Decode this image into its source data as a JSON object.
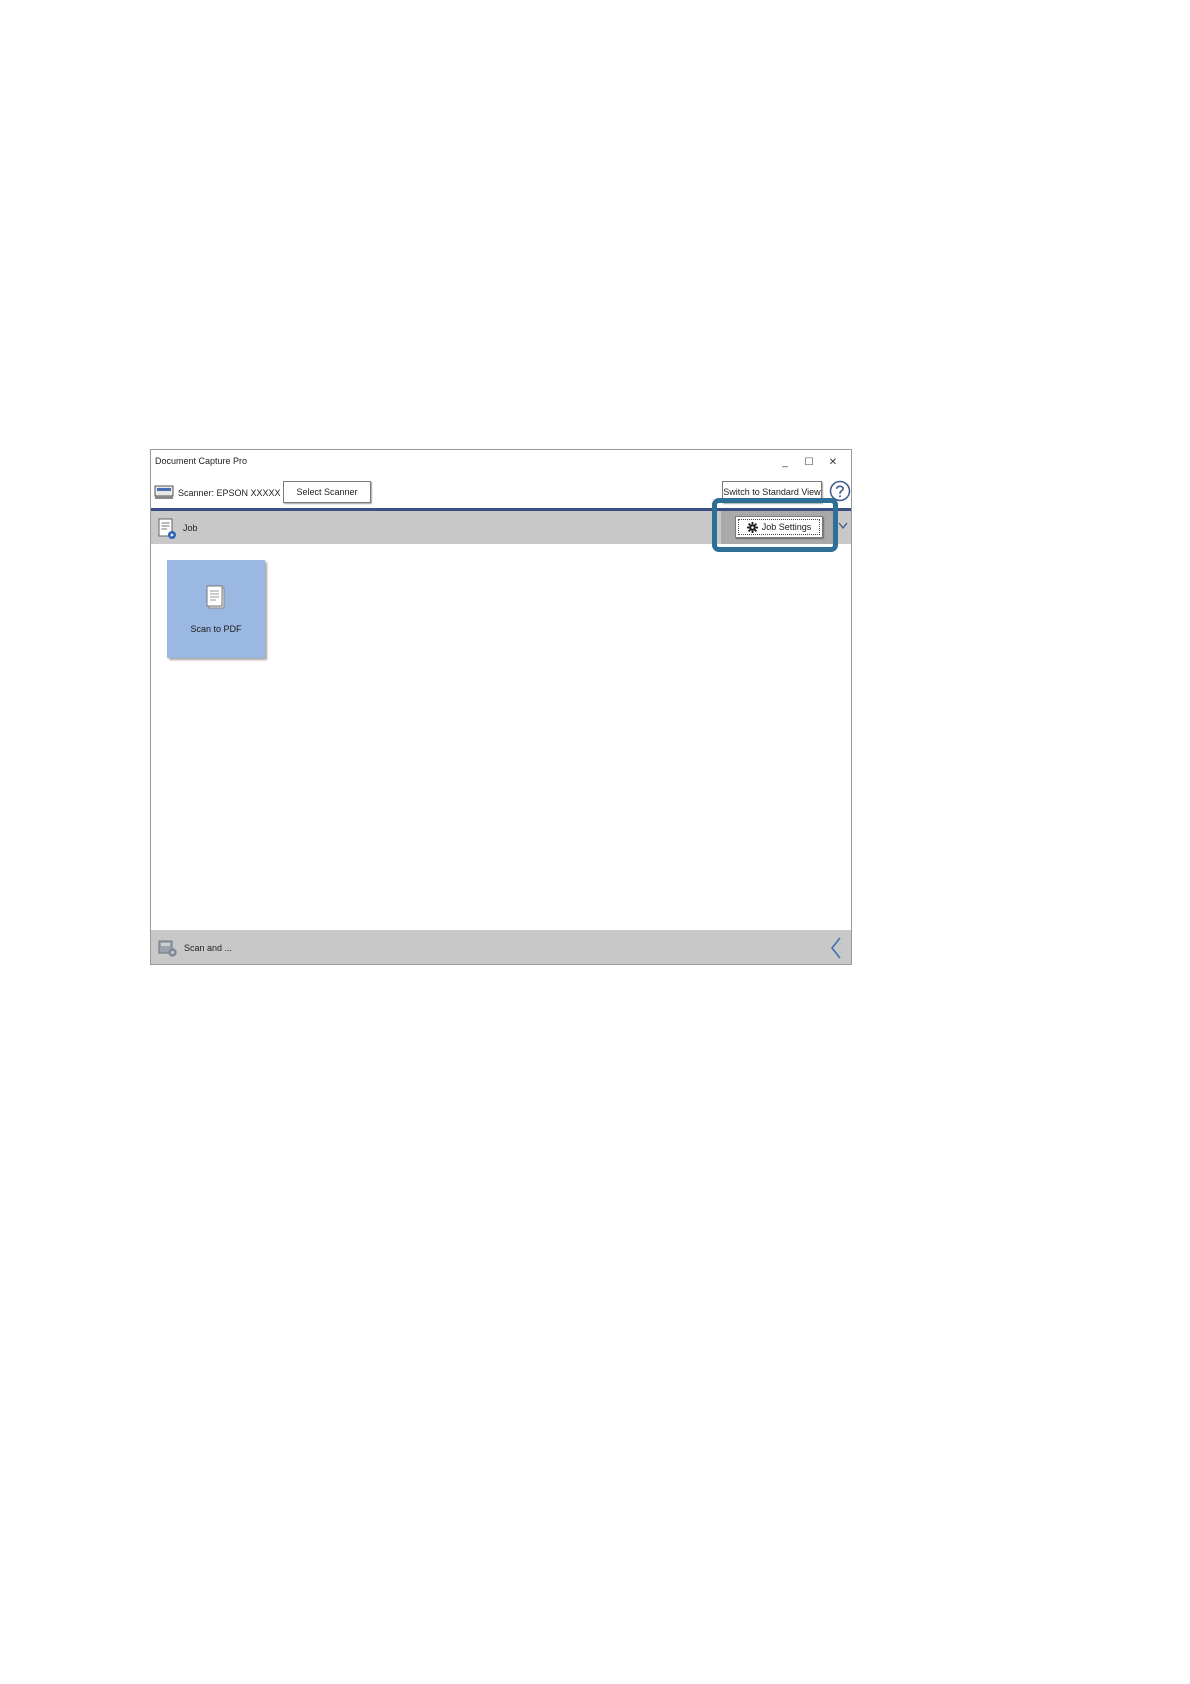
{
  "window": {
    "title": "Document Capture Pro",
    "controls": {
      "minimize": "_",
      "maximize": "☐",
      "close": "✕"
    }
  },
  "toolbar": {
    "scanner_label": "Scanner: EPSON XXXXX",
    "select_scanner_label": "Select Scanner",
    "switch_view_label": "Switch to Standard View",
    "help_icon": "help-icon"
  },
  "job_bar": {
    "label": "Job",
    "job_settings_label": "Job Settings"
  },
  "jobs": [
    {
      "label": "Scan to PDF",
      "icon": "document-icon"
    }
  ],
  "bottom_bar": {
    "label": "Scan and ..."
  },
  "colors": {
    "accent_line": "#3c4f86",
    "highlight": "#2f6e96",
    "job_tile": "#9ab8e2",
    "bar_gray": "#c8c8c8"
  }
}
